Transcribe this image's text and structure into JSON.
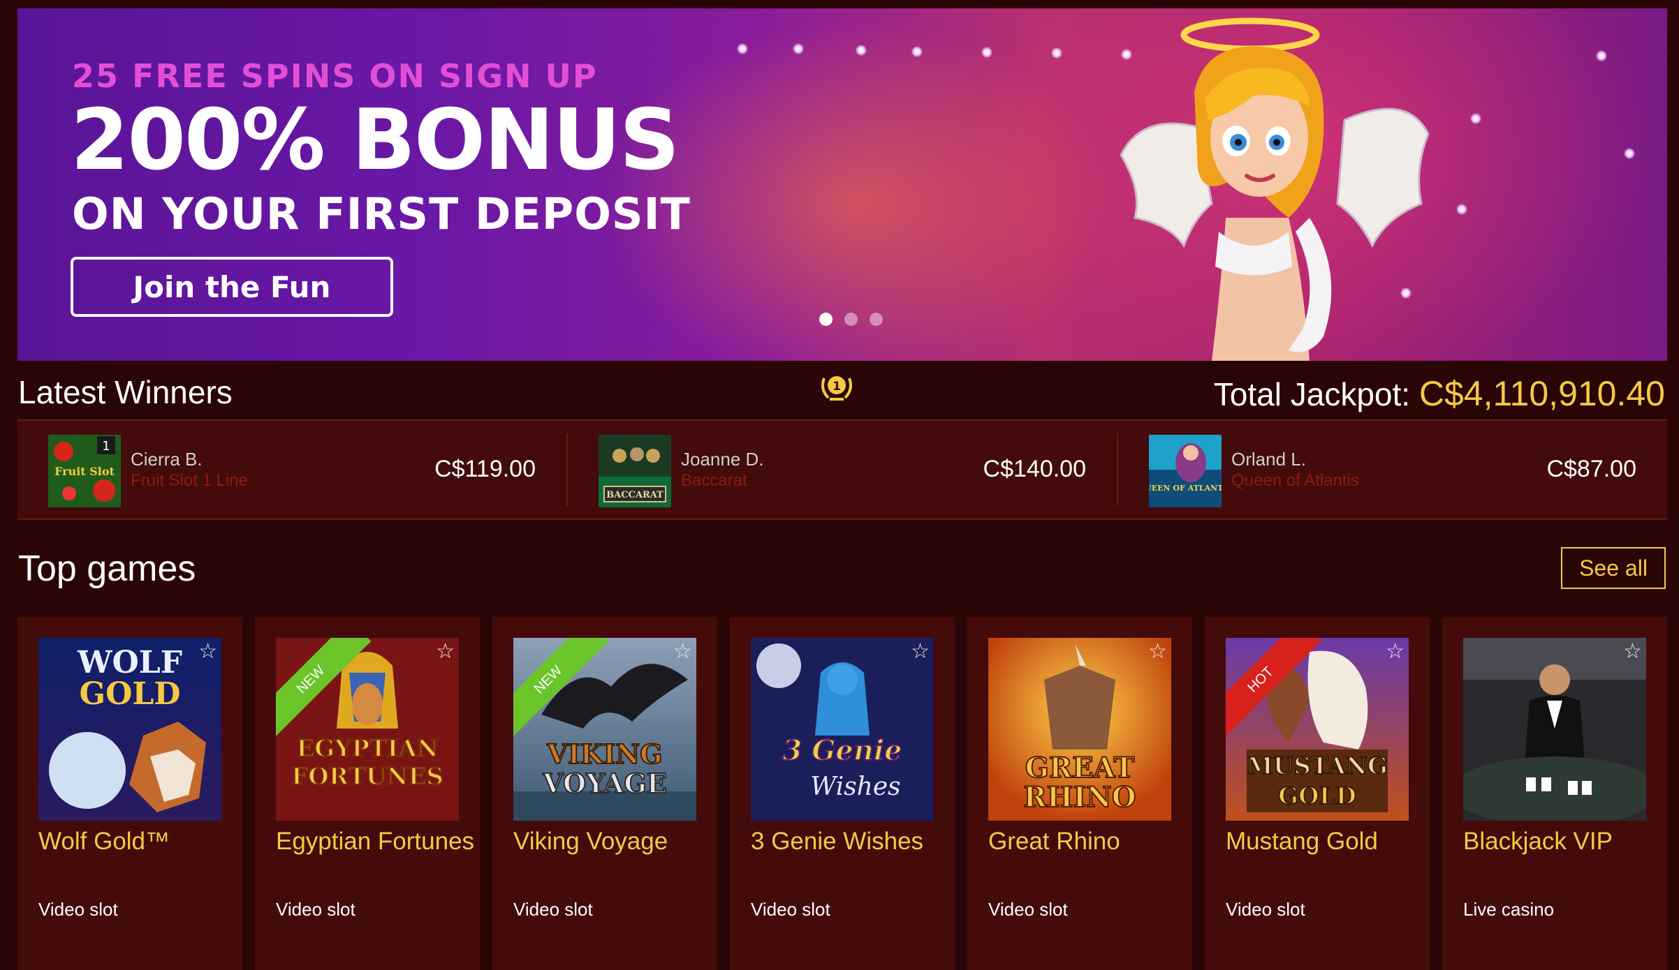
{
  "hero": {
    "subheading": "25 FREE SPINS ON SIGN UP",
    "heading": "200% BONUS",
    "subheading2": "ON YOUR FIRST DEPOSIT",
    "cta_label": "Join the Fun",
    "slides": 3,
    "active_slide": 1
  },
  "latest_winners": {
    "title": "Latest Winners",
    "jackpot_label": "Total Jackpot:",
    "jackpot_amount": "C$4,110,910.40",
    "items": [
      {
        "name": "Cierra B.",
        "game": "Fruit Slot 1 Line",
        "amount": "C$119.00",
        "thumb_text": "Fruit Slot",
        "badge": "1"
      },
      {
        "name": "Joanne D.",
        "game": "Baccarat",
        "amount": "C$140.00",
        "thumb_text": "BACCARAT"
      },
      {
        "name": "Orland L.",
        "game": "Queen of Atlantis",
        "amount": "C$87.00",
        "thumb_text": "QUEEN OF ATLANTIS"
      }
    ]
  },
  "top_games": {
    "title": "Top games",
    "see_all_label": "See all",
    "games": [
      {
        "title": "Wolf Gold™",
        "category": "Video slot",
        "art_line1": "WOLF",
        "art_line2": "GOLD",
        "ribbon": ""
      },
      {
        "title": "Egyptian Fortunes",
        "category": "Video slot",
        "art_line1": "EGYPTIAN",
        "art_line2": "FORTUNES",
        "ribbon": "NEW"
      },
      {
        "title": "Viking Voyage",
        "category": "Video slot",
        "art_line1": "VIKING",
        "art_line2": "VOYAGE",
        "ribbon": "NEW"
      },
      {
        "title": "3 Genie Wishes",
        "category": "Video slot",
        "art_line1": "3 Genie",
        "art_line2": "Wishes",
        "ribbon": ""
      },
      {
        "title": "Great Rhino",
        "category": "Video slot",
        "art_line1": "GREAT",
        "art_line2": "RHINO",
        "ribbon": ""
      },
      {
        "title": "Mustang Gold",
        "category": "Video slot",
        "art_line1": "MUSTANG",
        "art_line2": "GOLD",
        "ribbon": "HOT"
      },
      {
        "title": "Blackjack VIP",
        "category": "Live casino",
        "art_line1": "",
        "art_line2": "",
        "ribbon": ""
      }
    ]
  },
  "colors": {
    "background": "#2a0505",
    "accent_gold": "#f6c945",
    "card_bg": "#440b0b",
    "new_ribbon": "#6cc42b",
    "hot_ribbon": "#d8211c"
  },
  "icons": [
    "laurel-trophy-icon",
    "favorite-star-icon"
  ]
}
